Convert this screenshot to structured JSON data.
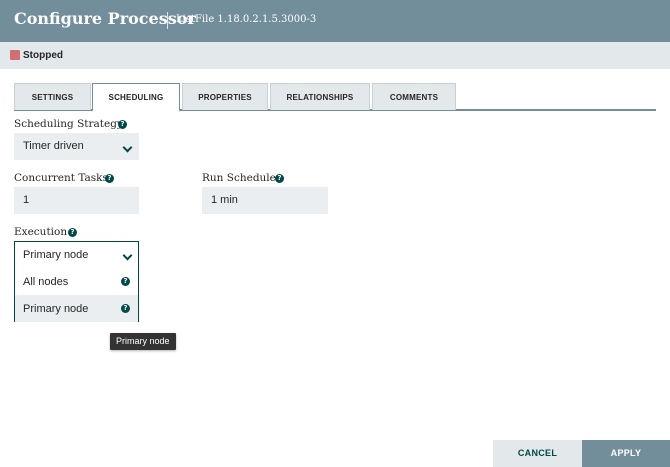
{
  "header": {
    "title": "Configure Processor",
    "subtitle": "ListFile 1.18.0.2.1.5.3000-3"
  },
  "status": {
    "label": "Stopped",
    "color": "#d17072"
  },
  "tabs": [
    {
      "label": "SETTINGS",
      "active": false
    },
    {
      "label": "SCHEDULING",
      "active": true
    },
    {
      "label": "PROPERTIES",
      "active": false
    },
    {
      "label": "RELATIONSHIPS",
      "active": false
    },
    {
      "label": "COMMENTS",
      "active": false
    }
  ],
  "scheduling": {
    "strategy_label": "Scheduling Strategy",
    "strategy_value": "Timer driven",
    "concurrent_label": "Concurrent Tasks",
    "concurrent_value": "1",
    "run_schedule_label": "Run Schedule",
    "run_schedule_value": "1 min",
    "execution_label": "Execution",
    "execution_value": "Primary node",
    "execution_options": [
      "All nodes",
      "Primary node"
    ],
    "tooltip": "Primary node"
  },
  "buttons": {
    "cancel": "CANCEL",
    "apply": "APPLY"
  },
  "colors": {
    "header": "#728e9b",
    "accent": "#004849",
    "field_bg": "#eaeef0"
  },
  "icons": {
    "help": "?"
  }
}
